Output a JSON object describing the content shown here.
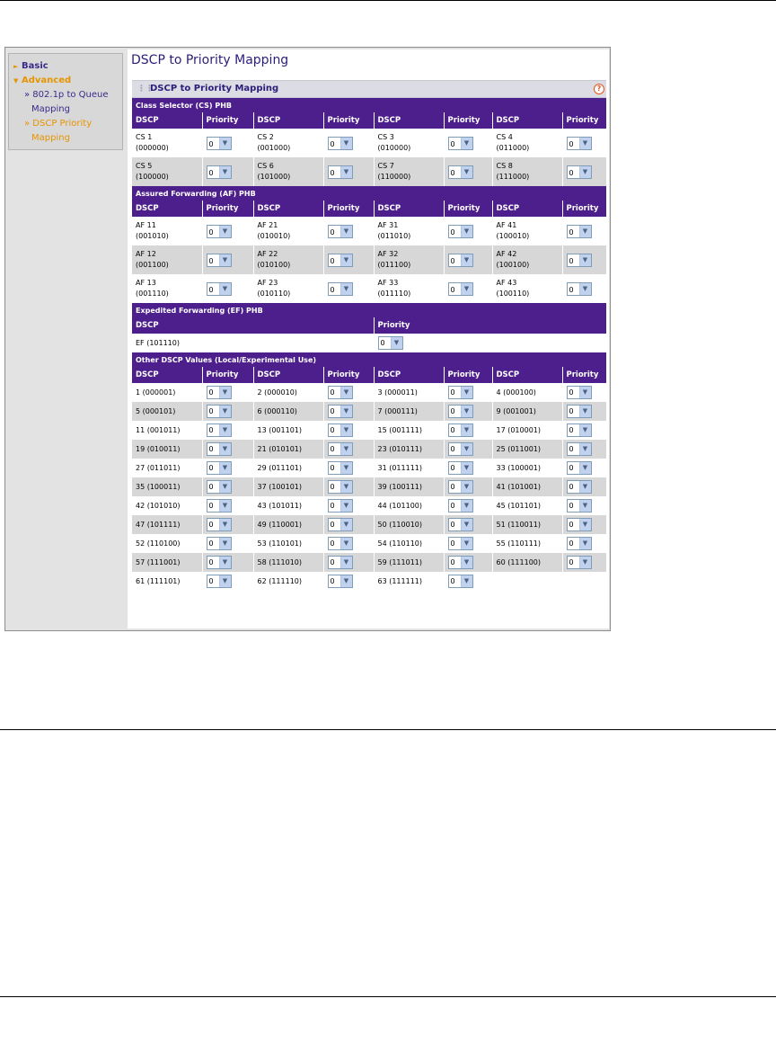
{
  "sidebar": {
    "basic_label": "Basic",
    "advanced_label": "Advanced",
    "items": [
      {
        "label_line1": "» 802.1p to Queue",
        "label_line2": "Mapping"
      },
      {
        "label_line1": "» DSCP Priority",
        "label_line2": "Mapping"
      }
    ]
  },
  "page_title": "DSCP to Priority Mapping",
  "panel_title": "DSCP to Priority Mapping",
  "help_icon": "?",
  "col_dscp": "DSCP",
  "col_priority": "Priority",
  "sections": [
    {
      "title": "Class Selector (CS) PHB",
      "rows": [
        [
          {
            "dscp": "CS 1",
            "code": "(000000)",
            "priority": "0"
          },
          {
            "dscp": "CS 2",
            "code": "(001000)",
            "priority": "0"
          },
          {
            "dscp": "CS 3",
            "code": "(010000)",
            "priority": "0"
          },
          {
            "dscp": "CS 4",
            "code": "(011000)",
            "priority": "0"
          }
        ],
        [
          {
            "dscp": "CS 5",
            "code": "(100000)",
            "priority": "0"
          },
          {
            "dscp": "CS 6",
            "code": "(101000)",
            "priority": "0"
          },
          {
            "dscp": "CS 7",
            "code": "(110000)",
            "priority": "0"
          },
          {
            "dscp": "CS 8",
            "code": "(111000)",
            "priority": "0"
          }
        ]
      ]
    },
    {
      "title": "Assured Forwarding (AF) PHB",
      "rows": [
        [
          {
            "dscp": "AF 11",
            "code": "(001010)",
            "priority": "0"
          },
          {
            "dscp": "AF 21",
            "code": "(010010)",
            "priority": "0"
          },
          {
            "dscp": "AF 31",
            "code": "(011010)",
            "priority": "0"
          },
          {
            "dscp": "AF 41",
            "code": "(100010)",
            "priority": "0"
          }
        ],
        [
          {
            "dscp": "AF 12",
            "code": "(001100)",
            "priority": "0"
          },
          {
            "dscp": "AF 22",
            "code": "(010100)",
            "priority": "0"
          },
          {
            "dscp": "AF 32",
            "code": "(011100)",
            "priority": "0"
          },
          {
            "dscp": "AF 42",
            "code": "(100100)",
            "priority": "0"
          }
        ],
        [
          {
            "dscp": "AF 13",
            "code": "(001110)",
            "priority": "0"
          },
          {
            "dscp": "AF 23",
            "code": "(010110)",
            "priority": "0"
          },
          {
            "dscp": "AF 33",
            "code": "(011110)",
            "priority": "0"
          },
          {
            "dscp": "AF 43",
            "code": "(100110)",
            "priority": "0"
          }
        ]
      ]
    }
  ],
  "ef": {
    "title": "Expedited Forwarding (EF) PHB",
    "dscp": "EF (101110)",
    "priority": "0"
  },
  "other": {
    "title": "Other DSCP Values (Local/Experimental Use)",
    "rows": [
      [
        {
          "dscp": "1 (000001)",
          "priority": "0"
        },
        {
          "dscp": "2 (000010)",
          "priority": "0"
        },
        {
          "dscp": "3 (000011)",
          "priority": "0"
        },
        {
          "dscp": "4 (000100)",
          "priority": "0"
        }
      ],
      [
        {
          "dscp": "5 (000101)",
          "priority": "0"
        },
        {
          "dscp": "6 (000110)",
          "priority": "0"
        },
        {
          "dscp": "7 (000111)",
          "priority": "0"
        },
        {
          "dscp": "9 (001001)",
          "priority": "0"
        }
      ],
      [
        {
          "dscp": "11 (001011)",
          "priority": "0"
        },
        {
          "dscp": "13 (001101)",
          "priority": "0"
        },
        {
          "dscp": "15 (001111)",
          "priority": "0"
        },
        {
          "dscp": "17 (010001)",
          "priority": "0"
        }
      ],
      [
        {
          "dscp": "19 (010011)",
          "priority": "0"
        },
        {
          "dscp": "21 (010101)",
          "priority": "0"
        },
        {
          "dscp": "23 (010111)",
          "priority": "0"
        },
        {
          "dscp": "25 (011001)",
          "priority": "0"
        }
      ],
      [
        {
          "dscp": "27 (011011)",
          "priority": "0"
        },
        {
          "dscp": "29 (011101)",
          "priority": "0"
        },
        {
          "dscp": "31 (011111)",
          "priority": "0"
        },
        {
          "dscp": "33 (100001)",
          "priority": "0"
        }
      ],
      [
        {
          "dscp": "35 (100011)",
          "priority": "0"
        },
        {
          "dscp": "37 (100101)",
          "priority": "0"
        },
        {
          "dscp": "39 (100111)",
          "priority": "0"
        },
        {
          "dscp": "41 (101001)",
          "priority": "0"
        }
      ],
      [
        {
          "dscp": "42 (101010)",
          "priority": "0"
        },
        {
          "dscp": "43 (101011)",
          "priority": "0"
        },
        {
          "dscp": "44 (101100)",
          "priority": "0"
        },
        {
          "dscp": "45 (101101)",
          "priority": "0"
        }
      ],
      [
        {
          "dscp": "47 (101111)",
          "priority": "0"
        },
        {
          "dscp": "49 (110001)",
          "priority": "0"
        },
        {
          "dscp": "50 (110010)",
          "priority": "0"
        },
        {
          "dscp": "51 (110011)",
          "priority": "0"
        }
      ],
      [
        {
          "dscp": "52 (110100)",
          "priority": "0"
        },
        {
          "dscp": "53 (110101)",
          "priority": "0"
        },
        {
          "dscp": "54 (110110)",
          "priority": "0"
        },
        {
          "dscp": "55 (110111)",
          "priority": "0"
        }
      ],
      [
        {
          "dscp": "57 (111001)",
          "priority": "0"
        },
        {
          "dscp": "58 (111010)",
          "priority": "0"
        },
        {
          "dscp": "59 (111011)",
          "priority": "0"
        },
        {
          "dscp": "60 (111100)",
          "priority": "0"
        }
      ],
      [
        {
          "dscp": "61 (111101)",
          "priority": "0"
        },
        {
          "dscp": "62 (111110)",
          "priority": "0"
        },
        {
          "dscp": "63 (111111)",
          "priority": "0"
        },
        null
      ]
    ]
  },
  "colors": {
    "header_purple": "#4d1f8c",
    "alt_row_gray": "#d7d7d7",
    "nav_orange": "#e69400",
    "nav_blue": "#3a2a8a"
  }
}
